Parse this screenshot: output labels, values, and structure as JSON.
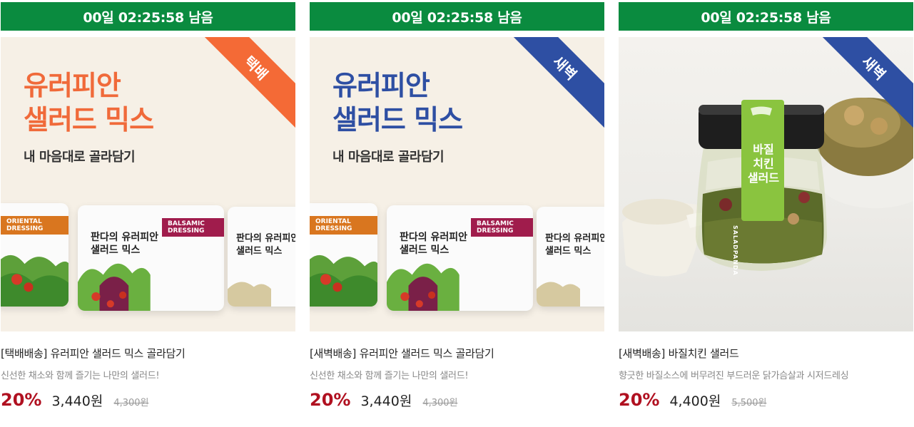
{
  "products": [
    {
      "timer": "00일 02:25:58 남음",
      "badge": "택배",
      "badge_color": "#f46a36",
      "headline_line1": "유러피안",
      "headline_line2": "샐러드 믹스",
      "headline_color": "#f06a3a",
      "subhead": "내 마음대로 골라담기",
      "bag_texts": {
        "dressing_left": "ORIENTAL DRESSING",
        "dressing_mid": "BALSAMIC DRESSING",
        "label_line1": "판다의 유러피안",
        "label_line2": "샐러드 믹스"
      },
      "title": "[택배배송] 유러피안 샐러드 믹스 골라담기",
      "desc": "신선한 채소와 함께 즐기는 나만의 샐러드!",
      "discount": "20%",
      "price": "3,440원",
      "original_price": "4,300원"
    },
    {
      "timer": "00일 02:25:58 남음",
      "badge": "새벽",
      "badge_color": "#2e4fa3",
      "headline_line1": "유러피안",
      "headline_line2": "샐러드 믹스",
      "headline_color": "#2e4fa3",
      "subhead": "내 마음대로 골라담기",
      "bag_texts": {
        "dressing_left": "ORIENTAL DRESSING",
        "dressing_mid": "BALSAMIC DRESSING",
        "label_line1": "판다의 유러피안",
        "label_line2": "샐러드 믹스"
      },
      "title": "[새벽배송] 유러피안 샐러드 믹스 골라담기",
      "desc": "신선한 채소와 함께 즐기는 나만의 샐러드!",
      "discount": "20%",
      "price": "3,440원",
      "original_price": "4,300원"
    },
    {
      "timer": "00일 02:25:58 남음",
      "badge": "새벽",
      "badge_color": "#2e4fa3",
      "jar_label": {
        "line1": "바질",
        "line2": "치킨",
        "line3": "샐러드",
        "brand": "SALADPANDA"
      },
      "title": "[새벽배송] 바질치킨 샐러드",
      "desc": "향긋한 바질소스에 버무려진 부드러운 닭가슴살과 시저드레싱",
      "discount": "20%",
      "price": "4,400원",
      "original_price": "5,500원"
    }
  ],
  "colors": {
    "timer_bg": "#0a8b3f",
    "discount": "#b01020"
  }
}
